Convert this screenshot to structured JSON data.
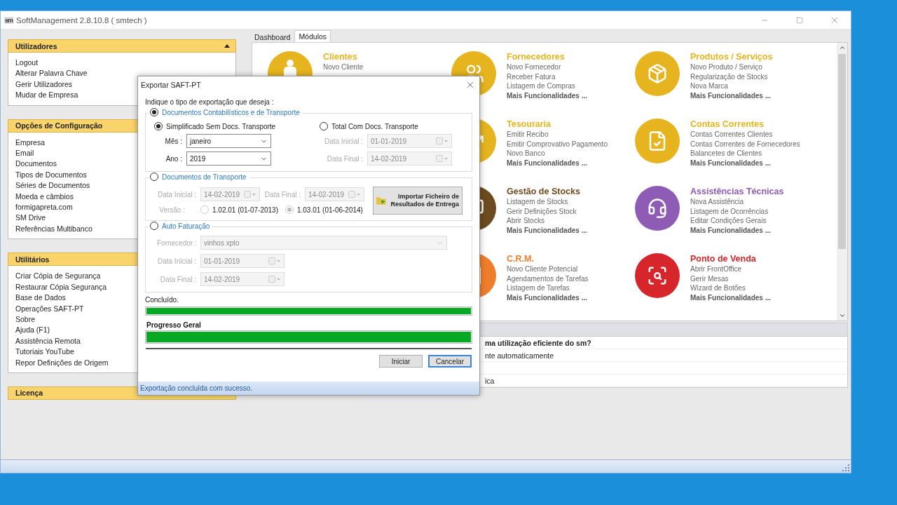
{
  "window": {
    "logo": "sm",
    "title": "SoftManagement 2.8.10.8 ( smtech )"
  },
  "sidebar": {
    "panels": [
      {
        "title": "Utilizadores",
        "expanded": true,
        "items": [
          "Logout",
          "Alterar Palavra Chave",
          "Gerir Utilizadores",
          "Mudar de Empresa"
        ]
      },
      {
        "title": "Opções de Configuração",
        "items": [
          "Empresa",
          "Email",
          "Documentos",
          "Tipos de Documentos",
          "Séries de Documentos",
          "Moeda e câmbios",
          "formigapreta.com",
          "SM Drive",
          "Referências Multibanco"
        ]
      },
      {
        "title": "Utilitários",
        "items": [
          "Criar Cópia de Segurança",
          "Restaurar Cópia Segurança",
          "Base de Dados",
          "Operações SAFT-PT",
          "Sobre",
          "Ajuda (F1)",
          "Assistência Remota",
          "Tutoriais YouTube",
          "Repor Definições de Origem"
        ]
      },
      {
        "title": "Licença"
      }
    ]
  },
  "tabs": [
    {
      "label": "Dashboard",
      "selected": false
    },
    {
      "label": "Módulos",
      "selected": true
    }
  ],
  "modules": {
    "columns": [
      [
        {
          "title": "Clientes",
          "color": "#e6b41e",
          "links": [
            "Novo Cliente"
          ]
        }
      ],
      [
        {
          "title": "Fornecedores",
          "color": "#e6b41e",
          "links": [
            "Novo Fornecedor",
            "Receber Fatura",
            "Listagem de Compras"
          ],
          "more": "Mais Funcionalidades ..."
        },
        {
          "title": "Tesouraria",
          "color": "#e6b41e",
          "links": [
            "Emitir Recibo",
            "Emitir Comprovativo Pagamento",
            "Novo Banco"
          ],
          "more": "Mais Funcionalidades ..."
        },
        {
          "title": "Gestão de Stocks",
          "color": "#6e4b1e",
          "links": [
            "Listagem de Stocks",
            "Gerir Definições Stock",
            "Abrir Stocks"
          ],
          "more": "Mais Funcionalidades ..."
        },
        {
          "title": "C.R.M.",
          "color": "#ee7d2c",
          "links": [
            "Novo Cliente Potencial",
            "Agendamentos de Tarefas",
            "Listagem de Tarefas"
          ],
          "more": "Mais Funcionalidades ..."
        }
      ],
      [
        {
          "title": "Produtos / Serviços",
          "color": "#e6b41e",
          "links": [
            "Novo Produto / Serviço",
            "Regularização de Stocks",
            "Nova Marca"
          ],
          "more": "Mais Funcionalidades ..."
        },
        {
          "title": "Contas Correntes",
          "color": "#e6b41e",
          "links": [
            "Contas Correntes Clientes",
            "Contas Correntes de Fornecedores",
            "Balancetes de Clientes"
          ],
          "more": "Mais Funcionalidades ..."
        },
        {
          "title": "Assistências Técnicas",
          "color": "#8e5cb4",
          "links": [
            "Nova Assistência",
            "Listagem de Ocorrências",
            "Editar Condições Gerais"
          ],
          "more": "Mais Funcionalidades ..."
        },
        {
          "title": "Ponto de Venda",
          "color": "#d6262c",
          "links": [
            "Abrir FrontOffice",
            "Gerir Mesas",
            "Wizard de Botões"
          ],
          "more": "Mais Funcionalidades ..."
        }
      ]
    ]
  },
  "tips": {
    "rows": [
      {
        "kind": "heading",
        "text": "ma utilização eficiente do sm?"
      },
      {
        "kind": "item",
        "text": "nte automaticamente"
      },
      {
        "kind": "item"
      },
      {
        "kind": "item",
        "text": "ica"
      }
    ]
  },
  "dialog": {
    "title": "Exportar SAFT-PT",
    "prompt": "Indique o tipo de exportação que deseja :",
    "groups": [
      {
        "kind": "options",
        "label": "Documentos Contabilísticos e de Transporte",
        "selected": true,
        "options": [
          {
            "label": "Simplificado Sem Docs. Transporte",
            "selected": true,
            "fields": [
              {
                "kind": "select",
                "label": "Mês :",
                "value": "janeiro",
                "disabled": false
              },
              {
                "kind": "select",
                "label": "Ano :",
                "value": "2019",
                "disabled": false
              }
            ]
          },
          {
            "label": "Total Com Docs. Transporte",
            "selected": false,
            "fields": [
              {
                "kind": "date",
                "label": "Data Inicial :",
                "value": "01-01-2019",
                "disabled": true
              },
              {
                "kind": "date",
                "label": "Data Final :",
                "value": "14-02-2019",
                "disabled": true
              }
            ]
          }
        ]
      },
      {
        "kind": "transport",
        "label": "Documentos de Transporte",
        "selected": false,
        "fields": [
          {
            "kind": "date",
            "label": "Data Inicial :",
            "value": "14-02-2019",
            "disabled": true
          },
          {
            "kind": "date",
            "label": "Data Final :",
            "value": "14-02-2019",
            "disabled": true
          }
        ],
        "version_label": "Versão :",
        "versions": [
          {
            "label": "1.02.01 (01-07-2013)",
            "selected": false
          },
          {
            "label": "1.03.01 (01-06-2014)",
            "selected": true
          }
        ],
        "button": "Importar Ficheiro de Resultados de Entrega"
      },
      {
        "kind": "fields",
        "label": "Auto Faturação",
        "selected": false,
        "fields": [
          {
            "kind": "wide-select",
            "label": "Fornecedor :",
            "value": "vinhos xpto",
            "disabled": true
          },
          {
            "kind": "date",
            "label": "Data Inicial :",
            "value": "01-01-2019",
            "disabled": true
          },
          {
            "kind": "date",
            "label": "Data Final :",
            "value": "14-02-2019",
            "disabled": true
          }
        ]
      }
    ],
    "progress": [
      {
        "kind": "plain",
        "label": "Concluído.",
        "level": 1
      },
      {
        "kind": "bold",
        "label": "Progresso Geral",
        "level": 1
      }
    ],
    "buttons": [
      {
        "label": "Iniciar",
        "default": false
      },
      {
        "label": "Cancelar",
        "default": true
      }
    ],
    "status": "Exportação concluída com sucesso."
  }
}
